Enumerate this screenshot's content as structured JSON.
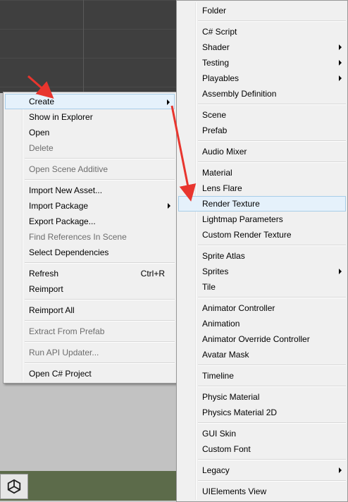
{
  "context_menu": {
    "items": [
      {
        "label": "Create",
        "submenu": true,
        "hover": true
      },
      {
        "label": "Show in Explorer"
      },
      {
        "label": "Open"
      },
      {
        "label": "Delete",
        "disabled": true
      },
      {
        "separator": true
      },
      {
        "label": "Open Scene Additive",
        "disabled": true
      },
      {
        "separator": true
      },
      {
        "label": "Import New Asset..."
      },
      {
        "label": "Import Package",
        "submenu": true
      },
      {
        "label": "Export Package..."
      },
      {
        "label": "Find References In Scene",
        "disabled": true
      },
      {
        "label": "Select Dependencies"
      },
      {
        "separator": true
      },
      {
        "label": "Refresh",
        "shortcut": "Ctrl+R"
      },
      {
        "label": "Reimport"
      },
      {
        "separator": true
      },
      {
        "label": "Reimport All"
      },
      {
        "separator": true
      },
      {
        "label": "Extract From Prefab",
        "disabled": true
      },
      {
        "separator": true
      },
      {
        "label": "Run API Updater...",
        "disabled": true
      },
      {
        "separator": true
      },
      {
        "label": "Open C# Project"
      }
    ]
  },
  "create_submenu": {
    "items": [
      {
        "label": "Folder"
      },
      {
        "separator": true
      },
      {
        "label": "C# Script"
      },
      {
        "label": "Shader",
        "submenu": true
      },
      {
        "label": "Testing",
        "submenu": true
      },
      {
        "label": "Playables",
        "submenu": true
      },
      {
        "label": "Assembly Definition"
      },
      {
        "separator": true
      },
      {
        "label": "Scene"
      },
      {
        "label": "Prefab"
      },
      {
        "separator": true
      },
      {
        "label": "Audio Mixer"
      },
      {
        "separator": true
      },
      {
        "label": "Material"
      },
      {
        "label": "Lens Flare"
      },
      {
        "label": "Render Texture",
        "hover": true
      },
      {
        "label": "Lightmap Parameters"
      },
      {
        "label": "Custom Render Texture"
      },
      {
        "separator": true
      },
      {
        "label": "Sprite Atlas"
      },
      {
        "label": "Sprites",
        "submenu": true
      },
      {
        "label": "Tile"
      },
      {
        "separator": true
      },
      {
        "label": "Animator Controller"
      },
      {
        "label": "Animation"
      },
      {
        "label": "Animator Override Controller"
      },
      {
        "label": "Avatar Mask"
      },
      {
        "separator": true
      },
      {
        "label": "Timeline"
      },
      {
        "separator": true
      },
      {
        "label": "Physic Material"
      },
      {
        "label": "Physics Material 2D"
      },
      {
        "separator": true
      },
      {
        "label": "GUI Skin"
      },
      {
        "label": "Custom Font"
      },
      {
        "separator": true
      },
      {
        "label": "Legacy",
        "submenu": true
      },
      {
        "separator": true
      },
      {
        "label": "UIElements View"
      }
    ]
  },
  "colors": {
    "annotation_arrow": "#e8352e",
    "hover_bg": "#e5f1fb",
    "hover_border": "#a8cde8"
  },
  "icons": {
    "unity_logo": "unity-logo-icon",
    "submenu_arrow": "chevron-right-icon"
  }
}
